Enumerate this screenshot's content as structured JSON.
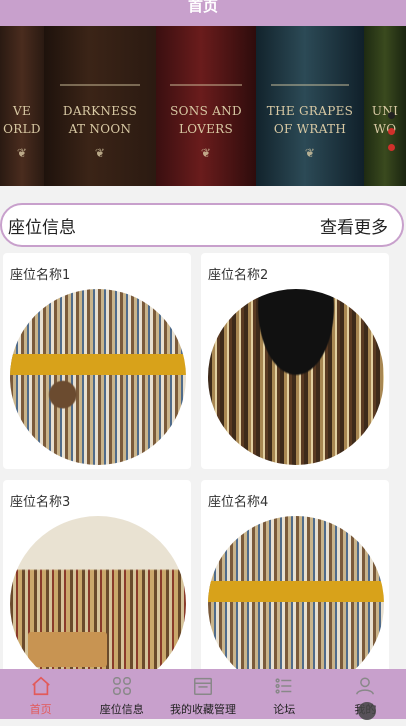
{
  "header": {
    "title": "首页"
  },
  "banner": {
    "books": [
      {
        "lines": [
          "VE",
          "ORLD"
        ]
      },
      {
        "lines": [
          "DARKNESS",
          "AT NOON"
        ]
      },
      {
        "lines": [
          "SONS AND",
          "LOVERS"
        ]
      },
      {
        "lines": [
          "THE GRAPES",
          "OF WRATH"
        ]
      },
      {
        "lines": [
          "UNI",
          "WO"
        ]
      }
    ],
    "indicators": [
      "#222222",
      "#d0302a",
      "#d0302a"
    ]
  },
  "section": {
    "title": "座位信息",
    "more_label": "查看更多"
  },
  "seats": [
    {
      "name": "座位名称1"
    },
    {
      "name": "座位名称2"
    },
    {
      "name": "座位名称3"
    },
    {
      "name": "座位名称4"
    }
  ],
  "tabbar": {
    "items": [
      {
        "label": "首页",
        "icon": "home-icon"
      },
      {
        "label": "座位信息",
        "icon": "grid-icon"
      },
      {
        "label": "我的收藏管理",
        "icon": "calendar-icon"
      },
      {
        "label": "论坛",
        "icon": "list-icon"
      },
      {
        "label": "我的",
        "icon": "user-icon"
      }
    ]
  },
  "colors": {
    "accent": "#c8a0cc",
    "active_tab": "#e25a5a"
  }
}
